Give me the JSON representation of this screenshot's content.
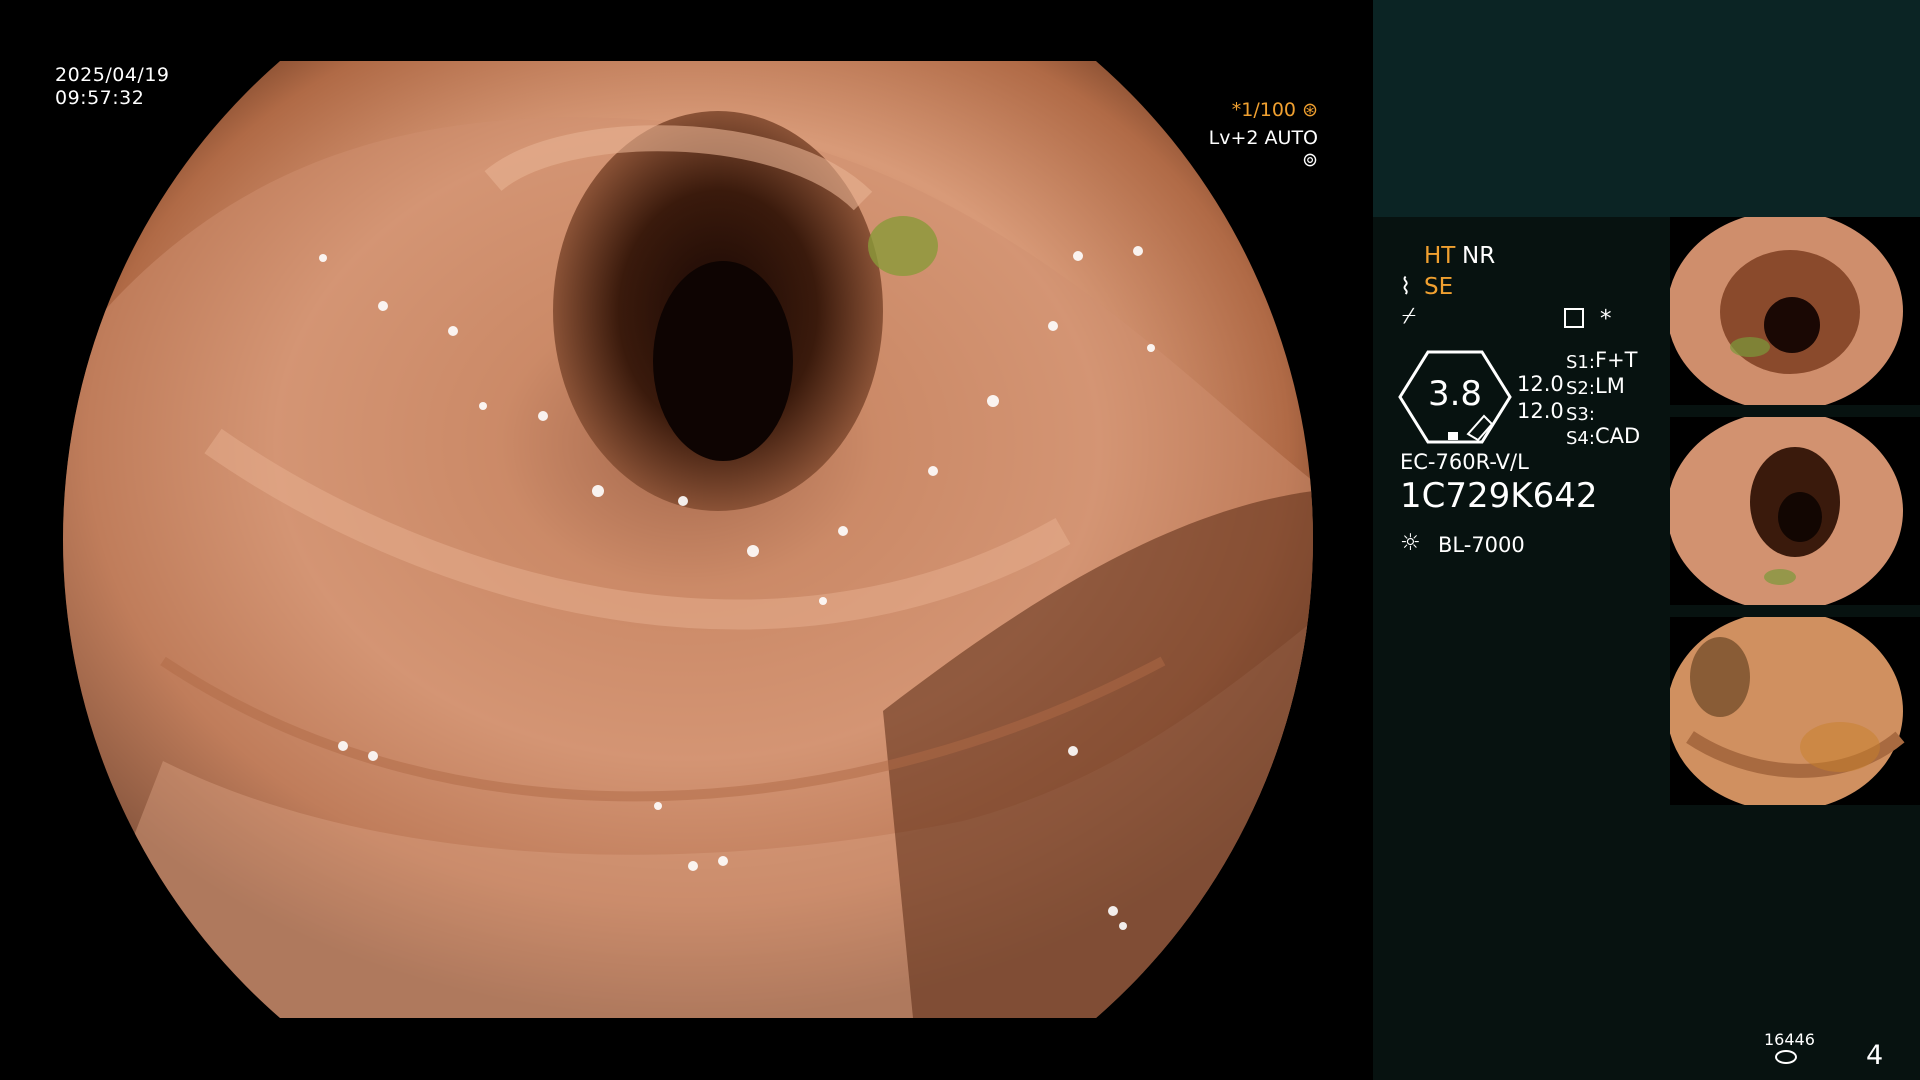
{
  "date": "2025/04/19",
  "time": "09:57:32",
  "shutter": "*1/100",
  "enhancement": "Lv+2 AUTO",
  "panel": {
    "ht": "HT",
    "nr": "NR",
    "se": "SE",
    "zoom": "3.8",
    "v1": "12.0",
    "v2": "12.0",
    "s1": "S1:",
    "s1v": "F+T",
    "s2": "S2:",
    "s2v": "LM",
    "s3": "S3:",
    "s3v": "",
    "s4": "S4:",
    "s4v": "CAD",
    "star": "*",
    "scope_model": "EC-760R-V/L",
    "serial": "1C729K642",
    "light_source": "BL-7000",
    "count": "16446",
    "image_number": "4"
  },
  "colors": {
    "accent": "#f0a030",
    "panel_bg": "#071210",
    "panel_top": "#0b2424"
  }
}
